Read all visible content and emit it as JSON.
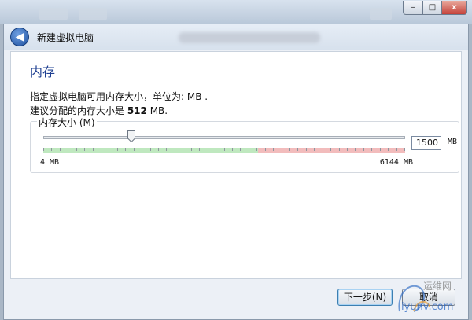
{
  "window": {
    "minimize_label": "–",
    "maximize_label": "□",
    "close_label": "x"
  },
  "wizard": {
    "title": "新建虚拟电脑",
    "back_icon": "arrow-left-icon"
  },
  "page": {
    "heading": "内存",
    "description_line1": "指定虚拟电脑可用内存大小，单位为: MB .",
    "description_line2_prefix": "建议分配的内存大小是 ",
    "description_line2_value": "512",
    "description_line2_suffix": " MB."
  },
  "memory": {
    "group_label": "内存大小 (M)",
    "min_label": "4 MB",
    "max_label": "6144 MB",
    "min_value": 4,
    "max_value": 6144,
    "recommended_value": 512,
    "current_value": "1500",
    "unit": "MB",
    "slider_position_fraction": 0.244,
    "safe_fraction": 0.594
  },
  "buttons": {
    "next_label": "下一步(N)",
    "cancel_label": "取消"
  },
  "watermark": {
    "text_line1": "运维网",
    "text_line2": "iyunv.com"
  },
  "colors": {
    "accent": "#1e3f91",
    "safe_zone": "#bfe8bf",
    "warn_zone": "#f2bcbc"
  }
}
